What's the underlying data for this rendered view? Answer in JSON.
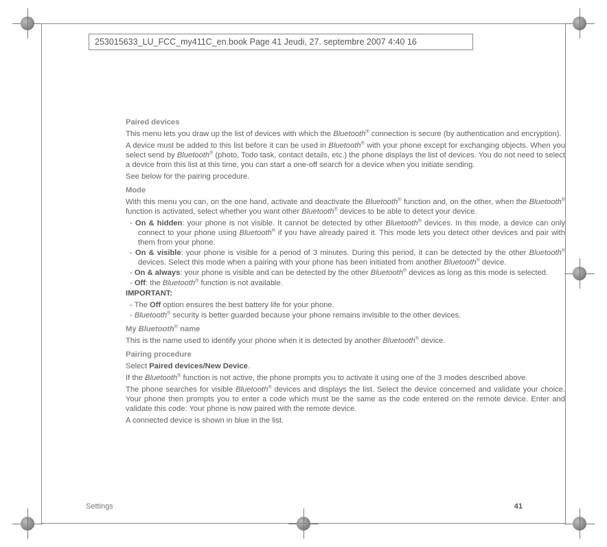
{
  "header": {
    "line": "253015633_LU_FCC_my411C_en.book  Page 41  Jeudi, 27. septembre 2007  4:40 16"
  },
  "sections": {
    "paired_devices": {
      "title": "Paired devices",
      "p1a": "This menu lets you draw up the list of devices with which the ",
      "p1b": " connection is secure (by authentication and encryption).",
      "p2a": "A device must be added to this list before it can be used in ",
      "p2b": " with your phone except for exchanging objects. When you select send by ",
      "p2c": " (photo, Todo task, contact details, etc.) the phone displays the list of devices. You do not need to select a device from this list at this time, you can start a one-off search for a device when you initiate sending.",
      "p3": "See below for the pairing procedure."
    },
    "mode": {
      "title": "Mode",
      "p1a": "With this menu you can, on the one hand, activate and deactivate the ",
      "p1b": " function and, on the other, when the ",
      "p1c": " function is activated, select whether you want other ",
      "p1d": " devices to be able to detect your device.",
      "items": {
        "hidden_label": "On & hidden",
        "hidden_a": ": your phone is not visible. It cannot be detected by other ",
        "hidden_b": " devices. In this mode, a device can only connect to your phone using ",
        "hidden_c": " if you have already paired it. This mode lets you detect other devices and pair with them from your phone.",
        "visible_label": "On & visible",
        "visible_a": ": your phone is visible for a period of 3 minutes. During this period, it can be detected by the other ",
        "visible_b": " devices. Select this mode when a pairing with your phone has been initiated from another ",
        "visible_c": " device.",
        "always_label": "On & always",
        "always_a": ": your phone is visible and can be detected by the other ",
        "always_b": " devices as long as this mode is selected.",
        "off_label": "Off",
        "off_a": ": the ",
        "off_b": " function is not available."
      },
      "important_label": "IMPORTANT",
      "imp1a": "The ",
      "imp1b": "Off",
      "imp1c": " option ensures the best battery life for your phone.",
      "imp2b": " security is better guarded because your phone remains invisible to the other devices."
    },
    "myname": {
      "title_a": "My ",
      "title_b": " name",
      "p1a": "This is the name used to identify your phone when it is detected by another ",
      "p1b": " device."
    },
    "pairing": {
      "title": "Pairing procedure",
      "p1a": "Select ",
      "p1b": "Paired devices/New Device",
      "p1c": ".",
      "p2a": "If the ",
      "p2b": " function is not active, the phone prompts you to activate it using one of the 3 modes described above.",
      "p3a": "The phone searches for visible ",
      "p3b": " devices and displays the list. Select the device concerned and validate your choice. Your phone then prompts you to enter a code which must be the same as the code entered on the remote device. Enter and validate this code: Your phone is now paired with the remote device.",
      "p4": "A connected device is shown in blue in the list."
    }
  },
  "common": {
    "bluetooth": "Bluetooth",
    "reg": "®"
  },
  "footer": {
    "left": "Settings",
    "page": "41"
  }
}
